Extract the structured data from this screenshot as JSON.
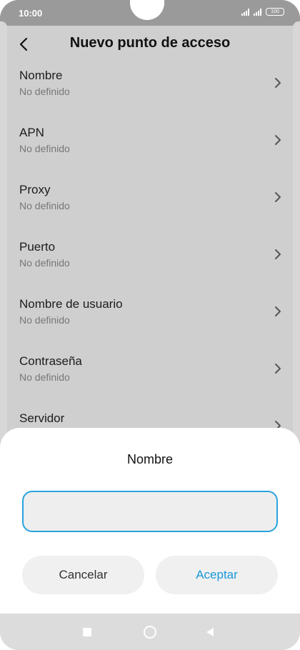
{
  "status_bar": {
    "time": "10:00",
    "battery": "100",
    "icons": [
      "signal-icon",
      "signal-icon",
      "battery-icon"
    ]
  },
  "header": {
    "title": "Nuevo punto de acceso",
    "back_icon": "back-arrow-icon"
  },
  "list": {
    "items": [
      {
        "title": "Nombre",
        "subtitle": "No definido"
      },
      {
        "title": "APN",
        "subtitle": "No definido"
      },
      {
        "title": "Proxy",
        "subtitle": "No definido"
      },
      {
        "title": "Puerto",
        "subtitle": "No definido"
      },
      {
        "title": "Nombre de usuario",
        "subtitle": "No definido"
      },
      {
        "title": "Contraseña",
        "subtitle": "No definido"
      },
      {
        "title": "Servidor",
        "subtitle": ""
      }
    ]
  },
  "dialog": {
    "title": "Nombre",
    "input_value": "",
    "cancel_label": "Cancelar",
    "ok_label": "Aceptar"
  },
  "colors": {
    "accent": "#1a98d9",
    "input_border": "#29a3df",
    "dim_background": "#cfcfcf"
  },
  "nav_bar": {
    "icons": [
      "recent-apps-icon",
      "home-icon",
      "back-icon"
    ]
  }
}
